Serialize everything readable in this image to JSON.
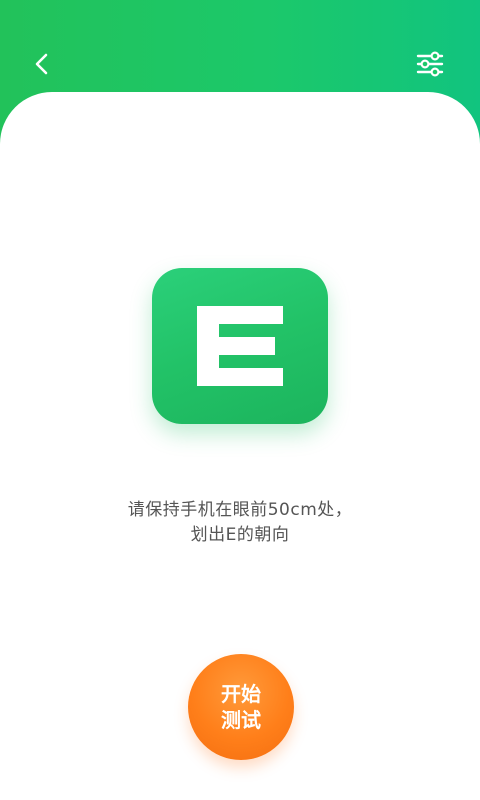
{
  "header": {
    "back_icon": "chevron-left-icon",
    "settings_icon": "sliders-icon"
  },
  "symbol": {
    "letter": "E",
    "icon": "tumbling-e-icon"
  },
  "instruction": {
    "line1": "请保持手机在眼前50cm处，",
    "line2": "划出E的朝向"
  },
  "start_button": {
    "line1": "开始",
    "line2": "测试"
  },
  "colors": {
    "header_green": "#1cc86a",
    "tile_green": "#22c267",
    "button_orange": "#ff7f1a",
    "text_gray": "#555555"
  }
}
